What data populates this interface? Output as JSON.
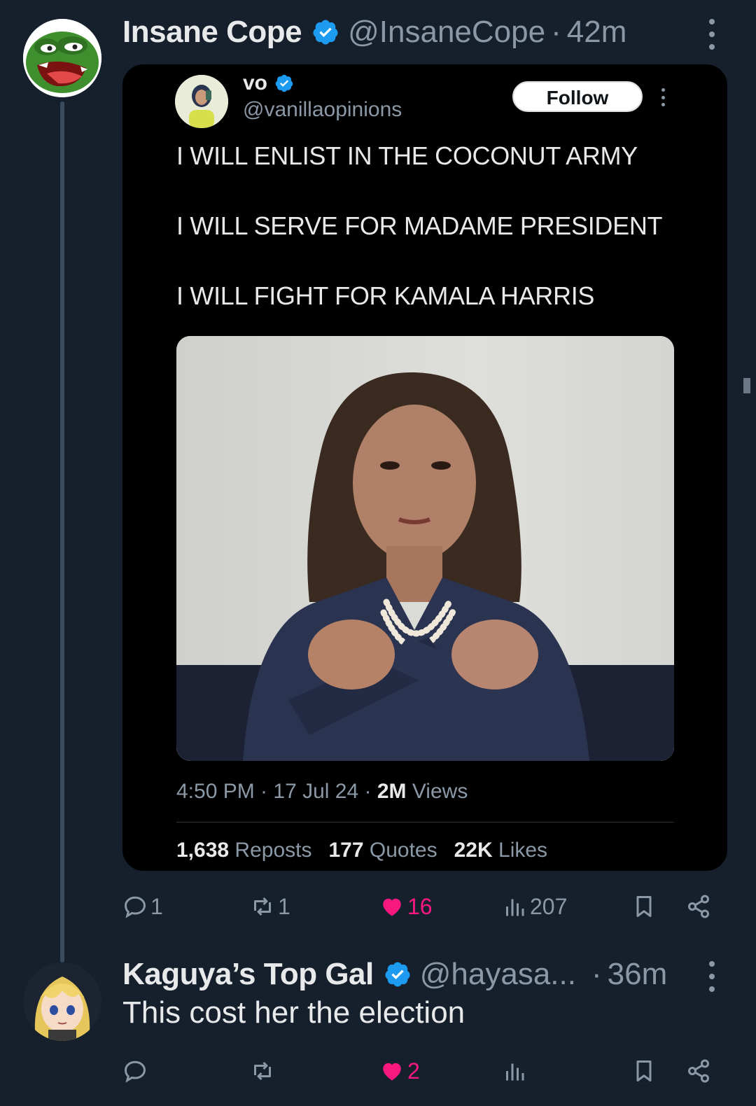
{
  "main_post": {
    "display_name": "Insane Cope",
    "handle": "@InsaneCope",
    "separator": "·",
    "time": "42m",
    "embedded": {
      "display_name": "vo",
      "handle": "@vanillaopinions",
      "follow_label": "Follow",
      "lines": [
        "I WILL ENLIST IN THE COCONUT ARMY",
        "I WILL SERVE FOR MADAME PRESIDENT",
        "I WILL FIGHT FOR KAMALA HARRIS"
      ],
      "timestamp": "4:50 PM · 17 Jul 24 ·",
      "views_count": "2M",
      "views_label": "Views",
      "reposts_count": "1,638",
      "reposts_label": "Reposts",
      "quotes_count": "177",
      "quotes_label": "Quotes",
      "likes_count": "22K",
      "likes_label": "Likes"
    },
    "actions": {
      "replies": "1",
      "reposts": "1",
      "likes": "16",
      "views": "207"
    }
  },
  "reply_post": {
    "display_name": "Kaguya’s Top Gal",
    "handle": "@hayasa...",
    "separator": "·",
    "time": "36m",
    "text": "This cost her the election",
    "actions": {
      "replies": "",
      "reposts": "",
      "likes": "2",
      "views": ""
    }
  },
  "colors": {
    "background": "#16202d",
    "verified_blue": "#1d9bf0",
    "like_pink": "#f91880",
    "muted_text": "#8b98a5"
  },
  "icons": [
    "verified-badge-icon",
    "more-options-icon",
    "reply-icon",
    "repost-icon",
    "heart-icon",
    "views-icon",
    "bookmark-icon",
    "share-icon"
  ]
}
